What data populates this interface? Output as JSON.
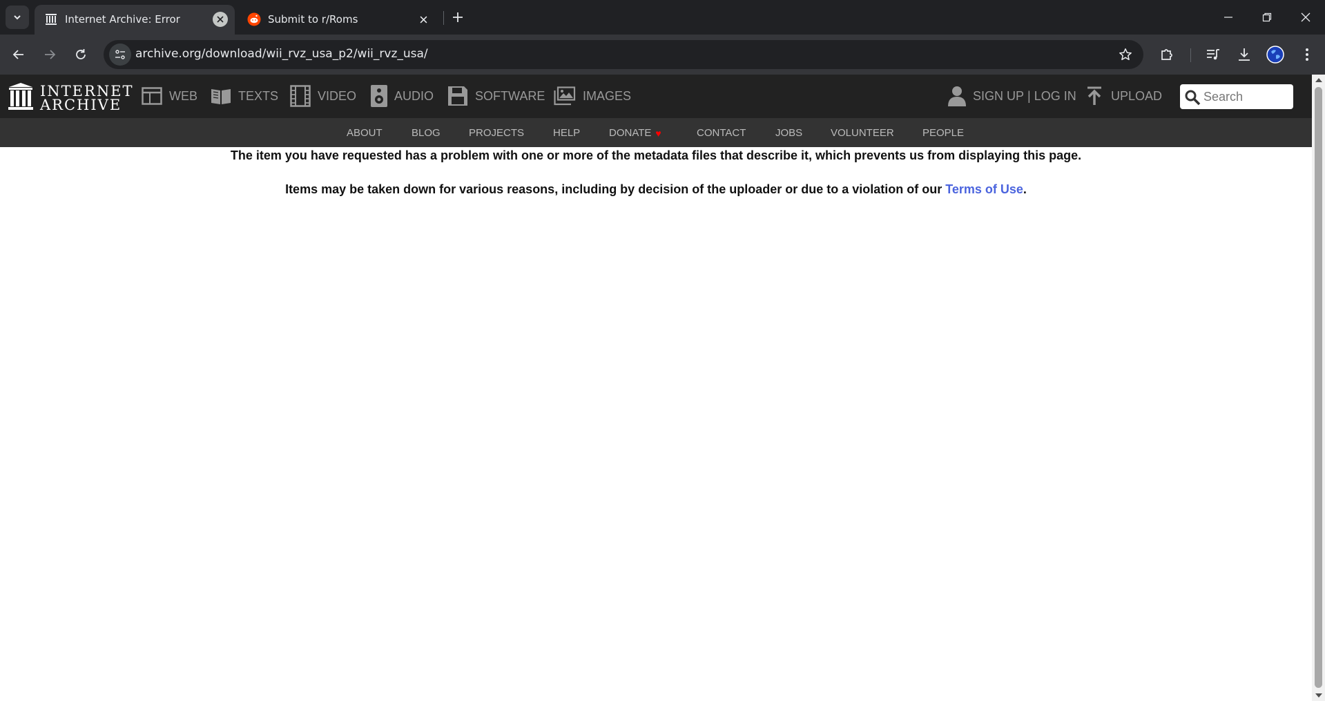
{
  "browser": {
    "tabs": [
      {
        "title": "Internet Archive: Error",
        "favicon": "internet-archive-icon",
        "active": true
      },
      {
        "title": "Submit to r/Roms",
        "favicon": "reddit-icon",
        "active": false
      }
    ],
    "url": "archive.org/download/wii_rvz_usa_p2/wii_rvz_usa/",
    "colors": {
      "tabbar": "#202124",
      "toolbar": "#35363a",
      "omnibox": "#202124"
    }
  },
  "ia": {
    "logo": {
      "line1": "INTERNET",
      "line2": "ARCHIVE"
    },
    "media": [
      {
        "label": "WEB",
        "icon": "web-icon"
      },
      {
        "label": "TEXTS",
        "icon": "texts-icon"
      },
      {
        "label": "VIDEO",
        "icon": "video-icon"
      },
      {
        "label": "AUDIO",
        "icon": "audio-icon"
      },
      {
        "label": "SOFTWARE",
        "icon": "software-icon"
      },
      {
        "label": "IMAGES",
        "icon": "images-icon"
      }
    ],
    "account": {
      "signup": "SIGN UP",
      "sep": "|",
      "login": "LOG IN"
    },
    "upload": "UPLOAD",
    "search_placeholder": "Search",
    "subnav": [
      "ABOUT",
      "BLOG",
      "PROJECTS",
      "HELP",
      "DONATE",
      "CONTACT",
      "JOBS",
      "VOLUNTEER",
      "PEOPLE"
    ],
    "donate_heart": "♥",
    "colors": {
      "topbar": "#222222",
      "subbar": "#333333",
      "link": "#4b64de"
    }
  },
  "content": {
    "line1": "The item you have requested has a problem with one or more of the metadata files that describe it, which prevents us from displaying this page.",
    "line2_prefix": "Items may be taken down for various reasons, including by decision of the uploader or due to a violation of our ",
    "line2_link": "Terms of Use",
    "line2_suffix": "."
  }
}
